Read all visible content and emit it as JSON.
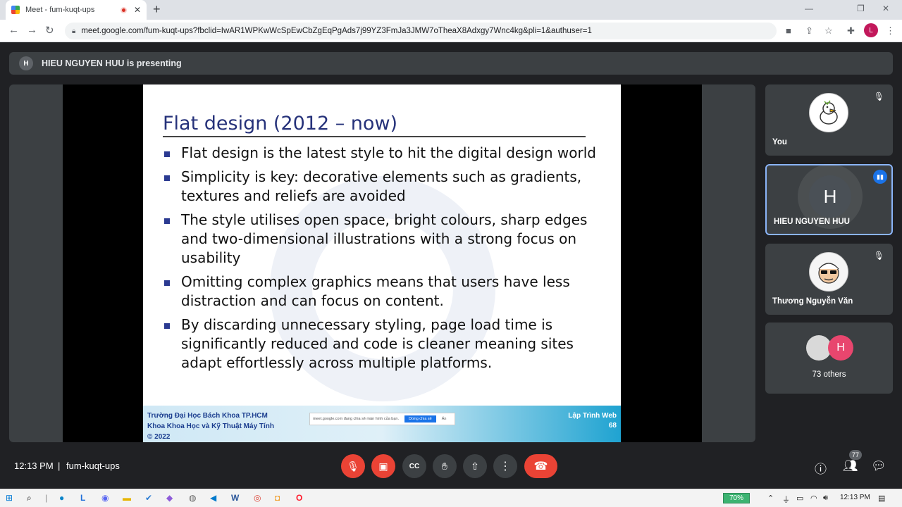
{
  "browser": {
    "tab_title": "Meet - fum-kuqt-ups",
    "tab_close": "✕",
    "new_tab": "+",
    "url": "meet.google.com/fum-kuqt-ups?fbclid=IwAR1WPKwWcSpEwCbZgEqPgAds7j99YZ3FmJa3JMW7oTheaX8Adxgy7Wnc4kg&pli=1&authuser=1",
    "profile_initial": "L"
  },
  "meet": {
    "presenter_initial": "H",
    "presenting_text": "HIEU NGUYEN HUU is presenting",
    "slide": {
      "title": "Flat design (2012 – now)",
      "bullets": [
        "Flat design is the latest style to hit the digital design world",
        "Simplicity is key: decorative elements such as gradients, textures and reliefs are avoided",
        "The style utilises open space, bright colours, sharp edges and two-dimensional illustrations with a strong focus on usability",
        "Omitting complex graphics means that users have less distraction and can focus on content.",
        "By discarding unnecessary styling, page load time is significantly reduced and code is cleaner meaning sites adapt effortlessly across multiple platforms."
      ],
      "footer_institution": "Trường Đại Học Bách Khoa TP.HCM\nKhoa Khoa Học và Kỹ Thuật Máy Tính\n© 2022",
      "footer_course": "Lập Trình Web\n68",
      "share_notice": "meet.google.com đang chia sẻ màn hình của bạn.",
      "share_stop": "Dừng chia sẻ",
      "share_hide": "Ẩn"
    },
    "tiles": {
      "you": "You",
      "presenter_name": "HIEU NGUYEN HUU",
      "presenter_initial": "H",
      "third_name": "Thương Nguyễn Văn",
      "others_initial": "H",
      "others_label": "73 others"
    },
    "controls": {
      "time": "12:13 PM",
      "separator": "|",
      "meeting_code": "fum-kuqt-ups",
      "participant_count": "77"
    }
  },
  "taskbar": {
    "battery": "70%",
    "clock": "12:13 PM"
  },
  "colors": {
    "meet_bg": "#202124",
    "tile_bg": "#3c4043",
    "danger": "#ea4335",
    "slide_title": "#26327a",
    "active_border": "#8ab4f8"
  }
}
